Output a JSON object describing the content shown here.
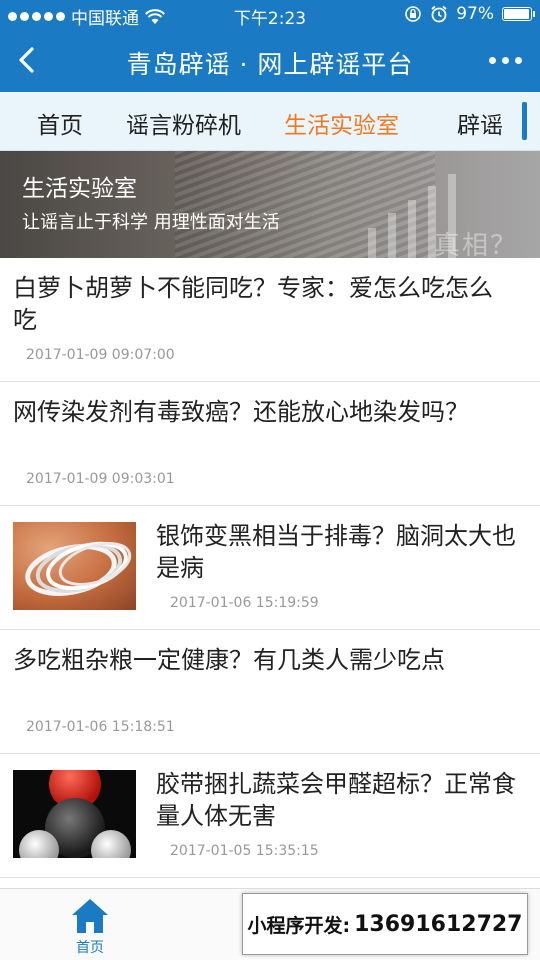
{
  "status_bar": {
    "carrier": "中国联通",
    "time": "下午2:23",
    "battery": "97%",
    "battery_level": 0.97
  },
  "nav": {
    "title": "青岛辟谣 · 网上辟谣平台"
  },
  "tabs": [
    {
      "label": "首页",
      "active": false
    },
    {
      "label": "谣言粉碎机",
      "active": false
    },
    {
      "label": "生活实验室",
      "active": true
    },
    {
      "label": "辟谣",
      "active": false
    }
  ],
  "banner": {
    "title": "生活实验室",
    "subtitle": "让谣言止于科学 用理性面对生活",
    "watermark_word": "真相？"
  },
  "articles": [
    {
      "title": "白萝卜胡萝卜不能同吃？专家：爱怎么吃怎么吃",
      "date": "2017-01-09 09:07:00"
    },
    {
      "title": "网传染发剂有毒致癌？还能放心地染发吗？",
      "date": "2017-01-09 09:03:01"
    },
    {
      "title": "银饰变黑相当于排毒？脑洞太大也是病",
      "date": "2017-01-06 15:19:59",
      "thumb": "silver-bracelets"
    },
    {
      "title": "多吃粗杂粮一定健康？有几类人需少吃点",
      "date": "2017-01-06 15:18:51"
    },
    {
      "title": "胶带捆扎蔬菜会甲醛超标？正常食量人体无害",
      "date": "2017-01-05 15:35:15",
      "thumb": "molecule-model"
    }
  ],
  "tabbar": {
    "home_label": "首页",
    "active_color": "#1a7bc4"
  },
  "promo": {
    "label": "小程序开发:",
    "phone": "13691612727"
  },
  "colors": {
    "primary": "#1a7bc4",
    "accent": "#f07a23",
    "tab_background": "#e9f5fa"
  }
}
